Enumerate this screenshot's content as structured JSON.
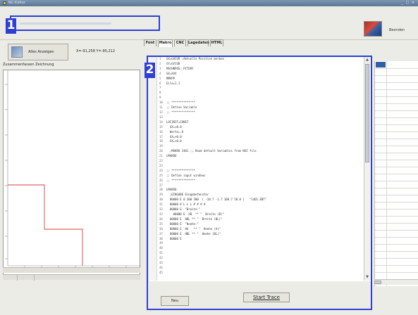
{
  "window": {
    "title": "NC-Editor",
    "controls": "_ □ ×"
  },
  "toolbar": {
    "beenden_label": "Beenden",
    "callout_1": "1"
  },
  "left_pane": {
    "alles_label": "Alles Anzeigen",
    "coords": "X=-91,258  Y=-95,212",
    "drawing_label": "Zusammenfassen Zeichnung"
  },
  "tabs": [
    {
      "label": "Font",
      "active": false
    },
    {
      "label": "Makro",
      "active": true
    },
    {
      "label": "CNC",
      "active": false
    },
    {
      "label": "Lagedaten",
      "active": false
    },
    {
      "label": "HTML",
      "active": false
    }
  ],
  "editor": {
    "callout_2": "2",
    "lines": [
      {
        "n": "1",
        "text": "GX=GXCUR ;Aktuelle Position merken"
      },
      {
        "n": "2",
        "text": "GY=GYCUR"
      },
      {
        "n": "3",
        "text": "MACHNPOS: PITORY"
      },
      {
        "n": "4",
        "text": "GX=XXX"
      },
      {
        "n": "5",
        "text": "MMAPP"
      },
      {
        "n": "6",
        "text": "Eile=1.1"
      },
      {
        "n": "7",
        "text": ""
      },
      {
        "n": "8",
        "text": ""
      },
      {
        "n": "9",
        "text": ""
      },
      {
        "n": "10",
        "text": ";; **************"
      },
      {
        "n": "11",
        "text": ";; Define Variable"
      },
      {
        "n": "12",
        "text": ";; **************"
      },
      {
        "n": "13",
        "text": ""
      },
      {
        "n": "14",
        "text": "LOCINIT=CONST"
      },
      {
        "n": "15",
        "text": "  GX=+0.0"
      },
      {
        "n": "16",
        "text": "  Werte=.0"
      },
      {
        "n": "17",
        "text": "  GX=+0.0"
      },
      {
        "n": "18",
        "text": "  GX=+0.0"
      },
      {
        "n": "19",
        "text": ""
      },
      {
        "n": "20",
        "text": "  ;MAKRO 1401 ;; Read default Variables from NXI file"
      },
      {
        "n": "21",
        "text": "LMAKRO"
      },
      {
        "n": "22",
        "text": ""
      },
      {
        "n": "23",
        "text": ""
      },
      {
        "n": "24",
        "text": ";; **************"
      },
      {
        "n": "25",
        "text": ";; Define input windows"
      },
      {
        "n": "26",
        "text": ";; **************"
      },
      {
        "n": "27",
        "text": ""
      },
      {
        "n": "28",
        "text": "LMAKRO"
      },
      {
        "n": "29",
        "text": "  ;EINGABE Eingabefenster"
      },
      {
        "n": "30",
        "text": "  00000 E 0 300 300  [ -10.7 -1.7 108.7 58.0 ]   \"1401.ENT\""
      },
      {
        "n": "31",
        "text": "  00000 # L L L # # # #"
      },
      {
        "n": "32",
        "text": "  00000 E  \"Breite:\""
      },
      {
        "n": "33",
        "text": "    00000 E  XB  ** \"  Breite (B)\""
      },
      {
        "n": "34",
        "text": "  00000 E  HBL ** \"  Breite (BL)\""
      },
      {
        "n": "35",
        "text": "  00000 E  \"Hoehe:\""
      },
      {
        "n": "36",
        "text": "  00000 E  HA   ** \"  Hoehe (A)\""
      },
      {
        "n": "37",
        "text": "  00000 E  HBL ** \"  Hoehe (BL)\""
      },
      {
        "n": "38",
        "text": "  00000 E"
      },
      {
        "n": "39",
        "text": ""
      },
      {
        "n": "40",
        "text": ""
      },
      {
        "n": "41",
        "text": ""
      },
      {
        "n": "42",
        "text": ""
      },
      {
        "n": "43",
        "text": ""
      },
      {
        "n": "44",
        "text": ""
      },
      {
        "n": "45",
        "text": ""
      }
    ]
  },
  "buttons": {
    "neu": "Neu",
    "start_trace": "Start Trace"
  }
}
